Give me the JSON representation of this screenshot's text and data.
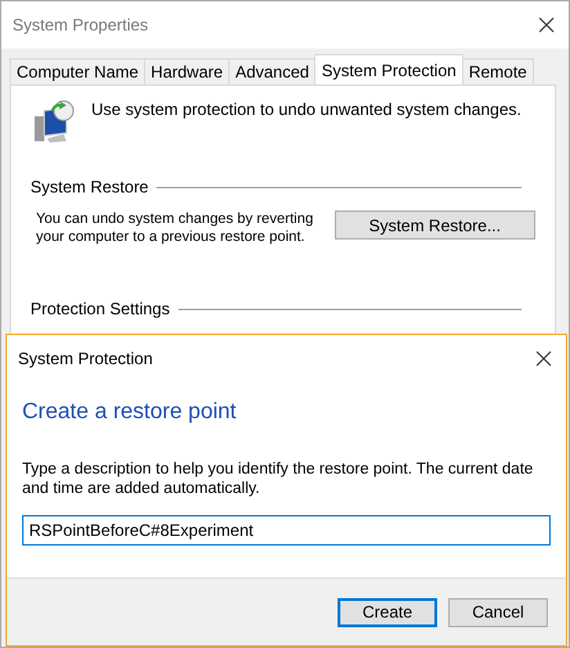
{
  "window": {
    "title": "System Properties"
  },
  "tabs": [
    {
      "label": "Computer Name",
      "selected": false
    },
    {
      "label": "Hardware",
      "selected": false
    },
    {
      "label": "Advanced",
      "selected": false
    },
    {
      "label": "System Protection",
      "selected": true
    },
    {
      "label": "Remote",
      "selected": false
    }
  ],
  "intro": "Use system protection to undo unwanted system changes.",
  "system_restore": {
    "heading": "System Restore",
    "description": "You can undo system changes by reverting your computer to a previous restore point.",
    "button": "System Restore..."
  },
  "protection_settings": {
    "heading": "Protection Settings"
  },
  "dialog": {
    "title": "System Protection",
    "heading": "Create a restore point",
    "description": "Type a description to help you identify the restore point. The current date and time are added automatically.",
    "input_value": "RSPointBeforeC#8Experiment",
    "buttons": [
      {
        "label": "Create",
        "default": true
      },
      {
        "label": "Cancel",
        "default": false
      }
    ]
  }
}
